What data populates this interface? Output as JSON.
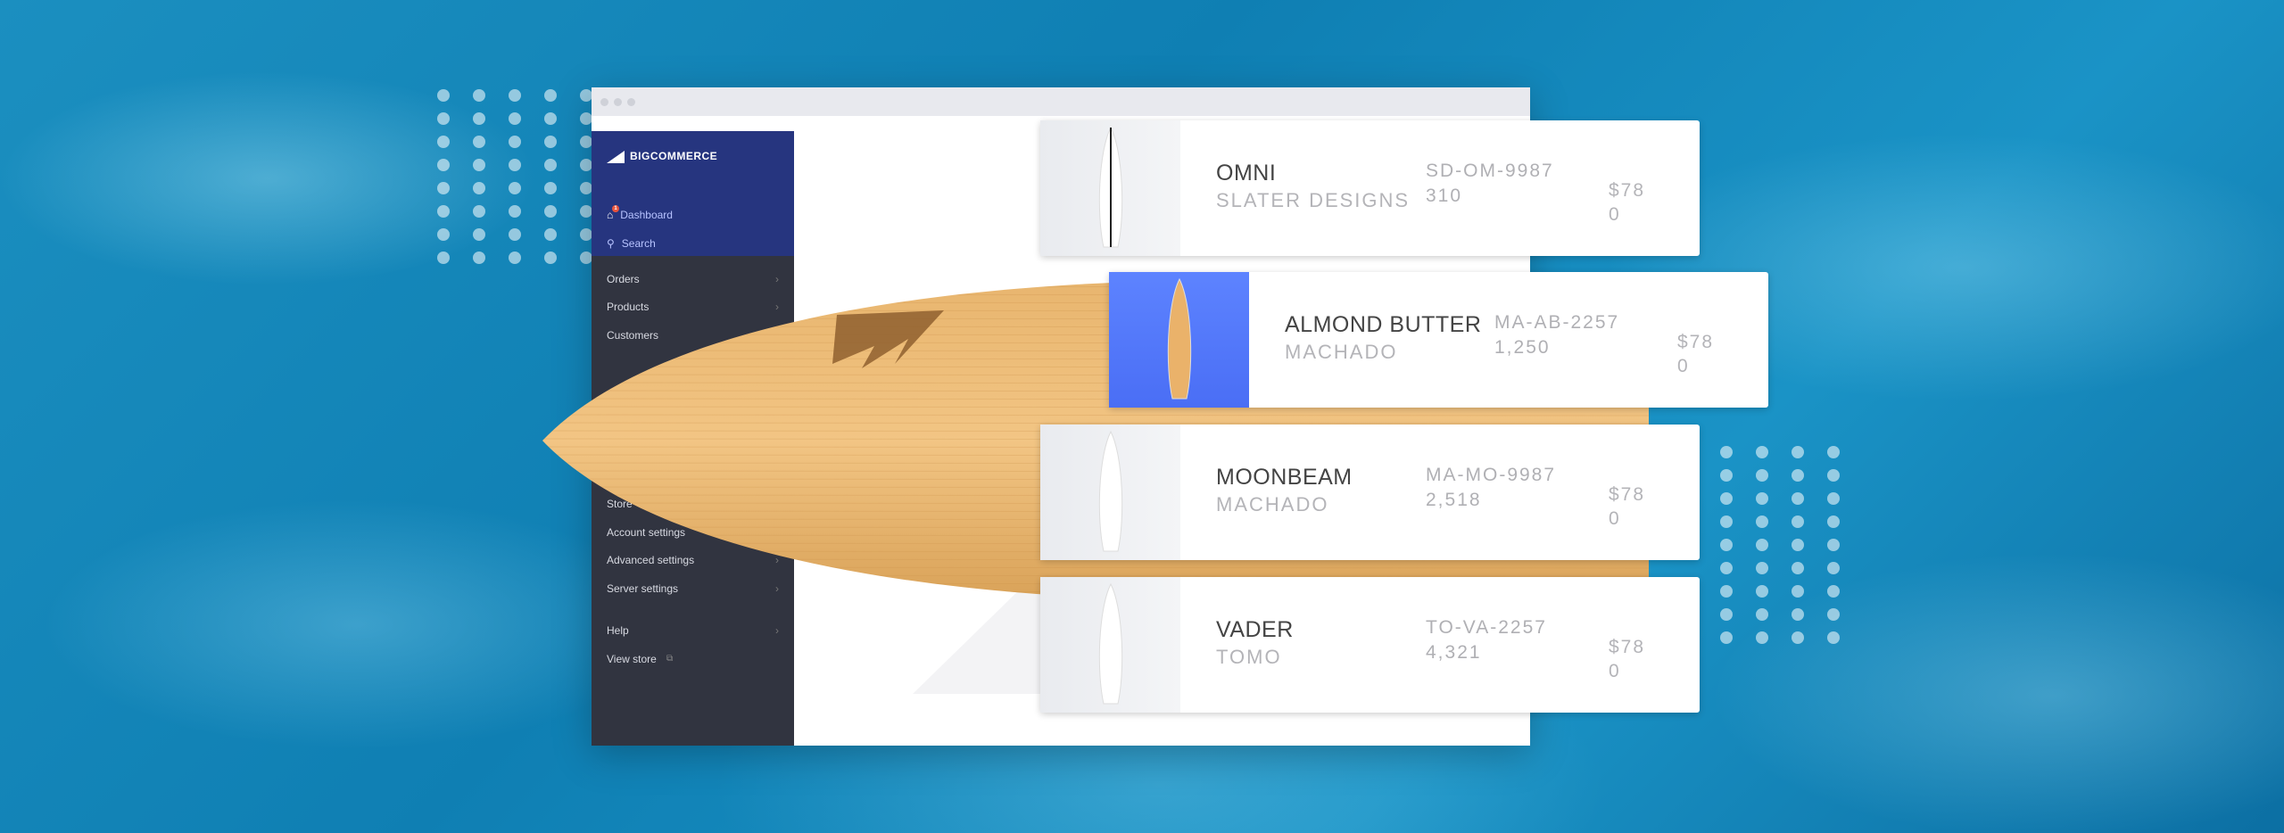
{
  "sidebar": {
    "logo": "BIGCOMMERCE",
    "top_links": [
      {
        "label": "Dashboard",
        "icon": "home-icon",
        "badge": "1"
      },
      {
        "label": "Search",
        "icon": "search-icon"
      }
    ],
    "items": [
      {
        "label": "Orders",
        "chevron": true
      },
      {
        "label": "Products",
        "chevron": true
      },
      {
        "label": "Customers",
        "chevron": false
      },
      {
        "label": "Store",
        "chevron": false
      },
      {
        "label": "Account settings",
        "chevron": false
      },
      {
        "label": "Advanced settings",
        "chevron": true
      },
      {
        "label": "Server settings",
        "chevron": true
      },
      {
        "label": "Help",
        "chevron": true
      },
      {
        "label": "View store",
        "chevron": false,
        "icon": "external-link-icon"
      }
    ]
  },
  "products": [
    {
      "name": "OMNI",
      "brand": "SLATER DESIGNS",
      "sku": "SD-OM-9987",
      "qty": "310",
      "price": "$780",
      "selected": false
    },
    {
      "name": "ALMOND BUTTER",
      "brand": "MACHADO",
      "sku": "MA-AB-2257",
      "qty": "1,250",
      "price": "$780",
      "selected": true
    },
    {
      "name": "MOONBEAM",
      "brand": "MACHADO",
      "sku": "MA-MO-9987",
      "qty": "2,518",
      "price": "$780",
      "selected": false
    },
    {
      "name": "VADER",
      "brand": "TOMO",
      "sku": "TO-VA-2257",
      "qty": "4,321",
      "price": "$780",
      "selected": false
    }
  ],
  "colors": {
    "sidebar_header": "#26357f",
    "sidebar": "#313440",
    "selected_thumb": "#4a6ef5",
    "water": "#1389bd"
  }
}
